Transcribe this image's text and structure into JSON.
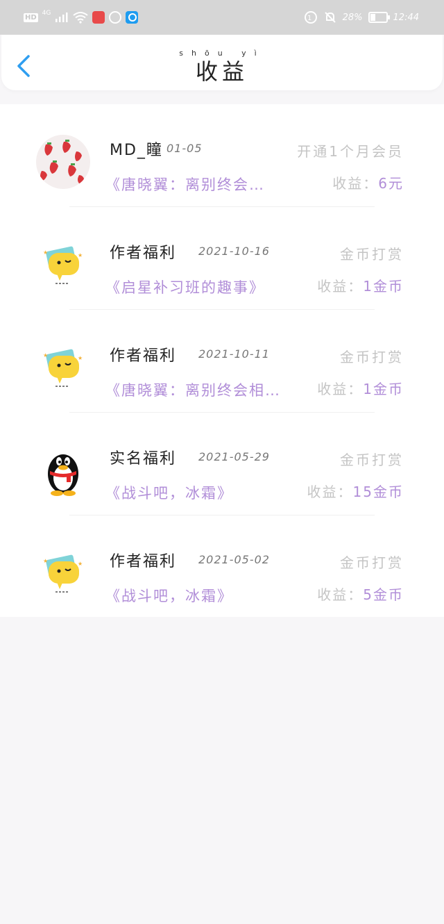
{
  "status_bar": {
    "hd": "HD",
    "network": "4G",
    "battery": "28%",
    "time": "12:44"
  },
  "header": {
    "title": "收益",
    "title_pinyin": "shōu yì"
  },
  "items": [
    {
      "name": "MD_瞳",
      "date": "01-05",
      "reward_type": "开通1个月会员",
      "book": "《唐晓翼：离别终会…",
      "income_label": "收益：",
      "income_value": "6元",
      "avatar": "strawberry-avatar"
    },
    {
      "name": "作者福利",
      "date": "2021-10-16",
      "reward_type": "金币打赏",
      "book": "《启星补习班的趣事》",
      "income_label": "收益：",
      "income_value": "1金币",
      "avatar": "speech-bubble-avatar"
    },
    {
      "name": "作者福利",
      "date": "2021-10-11",
      "reward_type": "金币打赏",
      "book": "《唐晓翼：离别终会相…",
      "income_label": "收益：",
      "income_value": "1金币",
      "avatar": "speech-bubble-avatar"
    },
    {
      "name": "实名福利",
      "date": "2021-05-29",
      "reward_type": "金币打赏",
      "book": "《战斗吧，冰霜》",
      "income_label": "收益：",
      "income_value": "15金币",
      "avatar": "qq-penguin-avatar"
    },
    {
      "name": "作者福利",
      "date": "2021-05-02",
      "reward_type": "金币打赏",
      "book": "《战斗吧，冰霜》",
      "income_label": "收益：",
      "income_value": "5金币",
      "avatar": "speech-bubble-avatar"
    }
  ],
  "colors": {
    "accent_purple": "#b18ed8",
    "muted_gray": "#c4c4c4",
    "back_blue": "#2f9ef0"
  }
}
